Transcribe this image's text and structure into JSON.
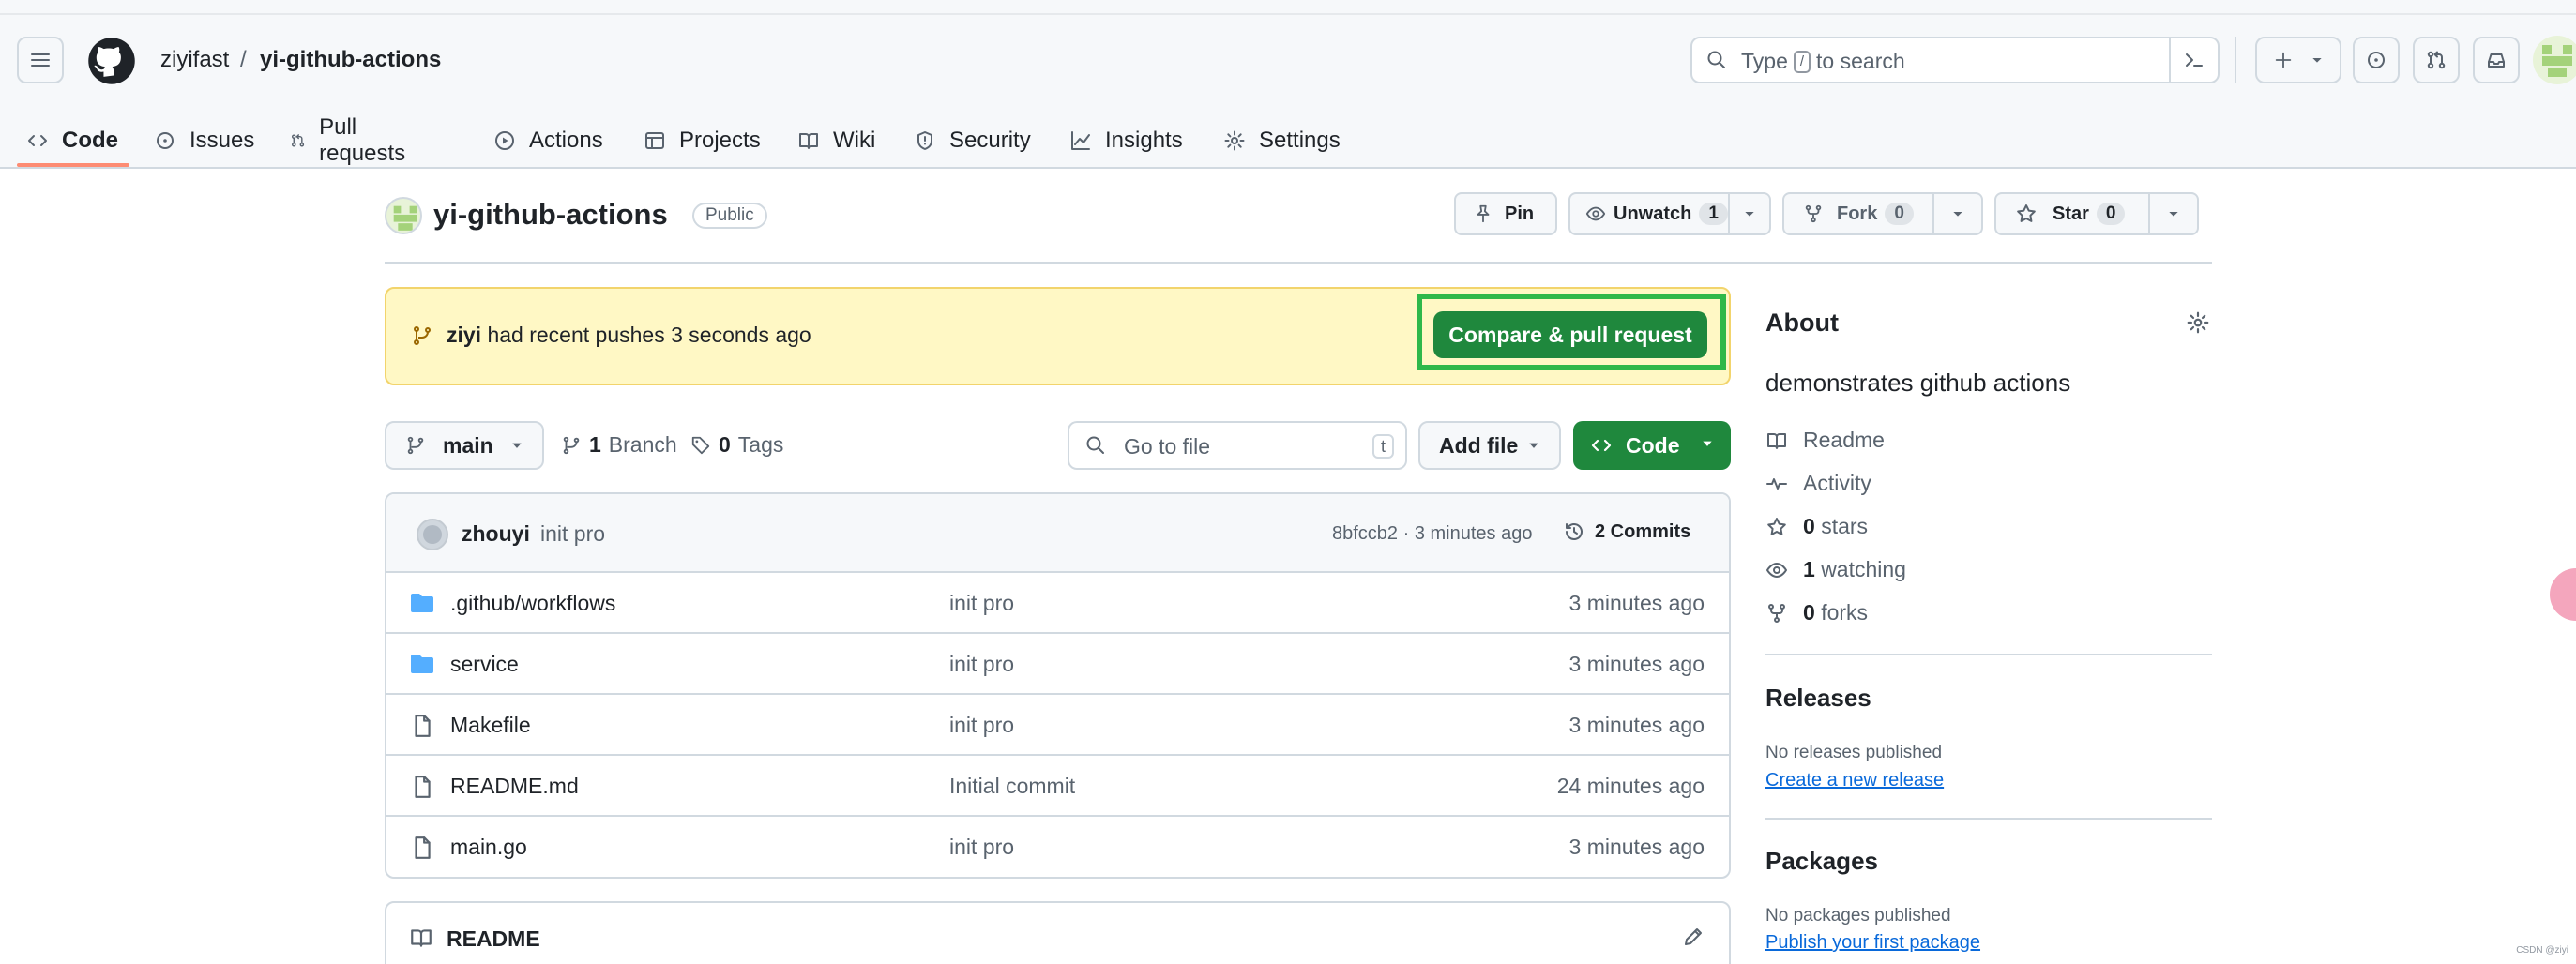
{
  "header": {
    "owner": "ziyifast",
    "separator": "/",
    "repo": "yi-github-actions",
    "search_text_before": "Type",
    "search_key": "/",
    "search_text_after": "to search"
  },
  "nav": {
    "tabs": [
      {
        "label": "Code"
      },
      {
        "label": "Issues"
      },
      {
        "label": "Pull requests"
      },
      {
        "label": "Actions"
      },
      {
        "label": "Projects"
      },
      {
        "label": "Wiki"
      },
      {
        "label": "Security"
      },
      {
        "label": "Insights"
      },
      {
        "label": "Settings"
      }
    ],
    "active_tab": "Code",
    "active_underline_color": "#fd8c73"
  },
  "repo": {
    "title": "yi-github-actions",
    "visibility": "Public",
    "pin_label": "Pin",
    "watch_label": "Unwatch",
    "watch_count": "1",
    "fork_label": "Fork",
    "fork_count": "0",
    "star_label": "Star",
    "star_count": "0"
  },
  "banner": {
    "user": "ziyi",
    "text": "had recent pushes 3 seconds ago",
    "button": "Compare & pull request",
    "highlight_color": "#2fb84a"
  },
  "toolbar": {
    "branch": "main",
    "branches_count": "1",
    "branches_label": "Branch",
    "tags_count": "0",
    "tags_label": "Tags",
    "goto_placeholder": "Go to file",
    "goto_key": "t",
    "add_file": "Add file",
    "code_button": "Code",
    "primary_color": "#1f883d"
  },
  "commit": {
    "author": "zhouyi",
    "message": "init pro",
    "hash_time": "8bfccb2 · 3 minutes ago",
    "commits_label": "2 Commits"
  },
  "files": [
    {
      "name": ".github/workflows",
      "type": "folder",
      "message": "init pro",
      "time": "3 minutes ago"
    },
    {
      "name": "service",
      "type": "folder",
      "message": "init pro",
      "time": "3 minutes ago"
    },
    {
      "name": "Makefile",
      "type": "file",
      "message": "init pro",
      "time": "3 minutes ago"
    },
    {
      "name": "README.md",
      "type": "file",
      "message": "Initial commit",
      "time": "24 minutes ago"
    },
    {
      "name": "main.go",
      "type": "file",
      "message": "init pro",
      "time": "3 minutes ago"
    }
  ],
  "readme": {
    "title": "README"
  },
  "about": {
    "heading": "About",
    "description": "demonstrates github actions",
    "readme": "Readme",
    "activity": "Activity",
    "stars_count": "0",
    "stars_label": "stars",
    "watching_count": "1",
    "watching_label": "watching",
    "forks_count": "0",
    "forks_label": "forks"
  },
  "releases": {
    "heading": "Releases",
    "empty": "No releases published",
    "link": "Create a new release"
  },
  "packages": {
    "heading": "Packages",
    "empty": "No packages published",
    "link": "Publish your first package"
  },
  "watermark": "CSDN @ziyi"
}
